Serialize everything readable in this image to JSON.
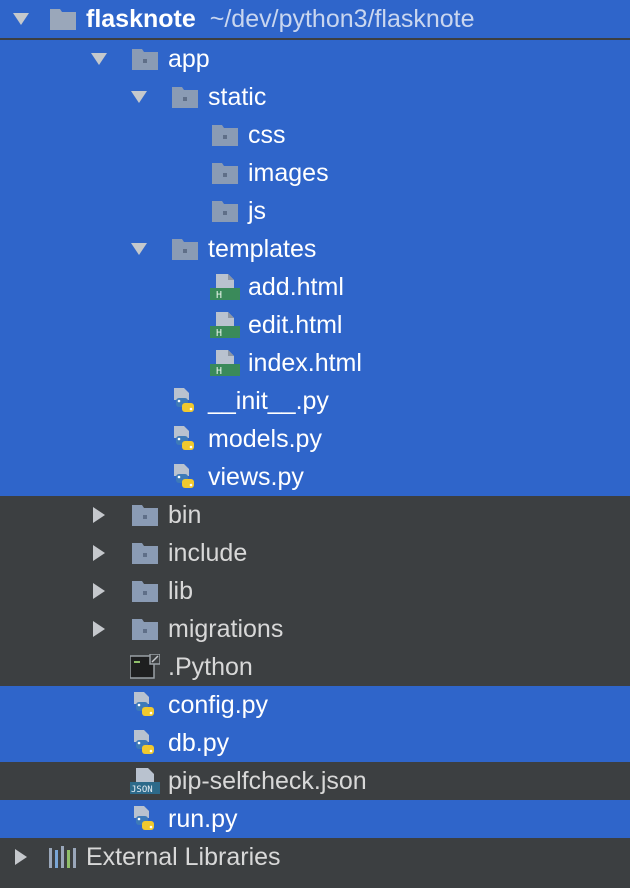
{
  "colors": {
    "panel_bg": "#3c3f41",
    "selection": "#2f65ca",
    "folder_icon": "#8a9bb4",
    "html_badge": "#3a8a5a",
    "python_blue": "#3d7ab8",
    "python_yellow": "#f0c92e",
    "text": "#d8d8d8"
  },
  "root": {
    "name": "flasknote",
    "path": "~/dev/python3/flasknote",
    "expanded": true,
    "selected": true,
    "icon": "folder-icon"
  },
  "items": [
    {
      "label": "app",
      "icon": "folder-icon",
      "arrow": "down",
      "selected": true
    },
    {
      "label": "static",
      "icon": "folder-icon",
      "arrow": "down",
      "selected": true
    },
    {
      "label": "css",
      "icon": "folder-icon",
      "arrow": "none",
      "selected": true
    },
    {
      "label": "images",
      "icon": "folder-icon",
      "arrow": "none",
      "selected": true
    },
    {
      "label": "js",
      "icon": "folder-icon",
      "arrow": "none",
      "selected": true
    },
    {
      "label": "templates",
      "icon": "folder-icon",
      "arrow": "down",
      "selected": true
    },
    {
      "label": "add.html",
      "icon": "html-file-icon",
      "arrow": "none",
      "selected": true
    },
    {
      "label": "edit.html",
      "icon": "html-file-icon",
      "arrow": "none",
      "selected": true
    },
    {
      "label": "index.html",
      "icon": "html-file-icon",
      "arrow": "none",
      "selected": true
    },
    {
      "label": "__init__.py",
      "icon": "python-file-icon",
      "arrow": "none",
      "selected": true
    },
    {
      "label": "models.py",
      "icon": "python-file-icon",
      "arrow": "none",
      "selected": true
    },
    {
      "label": "views.py",
      "icon": "python-file-icon",
      "arrow": "none",
      "selected": true
    },
    {
      "label": "bin",
      "icon": "folder-icon",
      "arrow": "right",
      "selected": false
    },
    {
      "label": "include",
      "icon": "folder-icon",
      "arrow": "right",
      "selected": false
    },
    {
      "label": "lib",
      "icon": "folder-icon",
      "arrow": "right",
      "selected": false
    },
    {
      "label": "migrations",
      "icon": "folder-icon",
      "arrow": "right",
      "selected": false
    },
    {
      "label": ".Python",
      "icon": "terminal-file-icon",
      "arrow": "none",
      "selected": false
    },
    {
      "label": "config.py",
      "icon": "python-file-icon",
      "arrow": "none",
      "selected": true
    },
    {
      "label": "db.py",
      "icon": "python-file-icon",
      "arrow": "none",
      "selected": true
    },
    {
      "label": "pip-selfcheck.json",
      "icon": "json-file-icon",
      "arrow": "none",
      "selected": false
    },
    {
      "label": "run.py",
      "icon": "python-file-icon",
      "arrow": "none",
      "selected": true
    },
    {
      "label": "External Libraries",
      "icon": "library-icon",
      "arrow": "right",
      "selected": false
    }
  ]
}
